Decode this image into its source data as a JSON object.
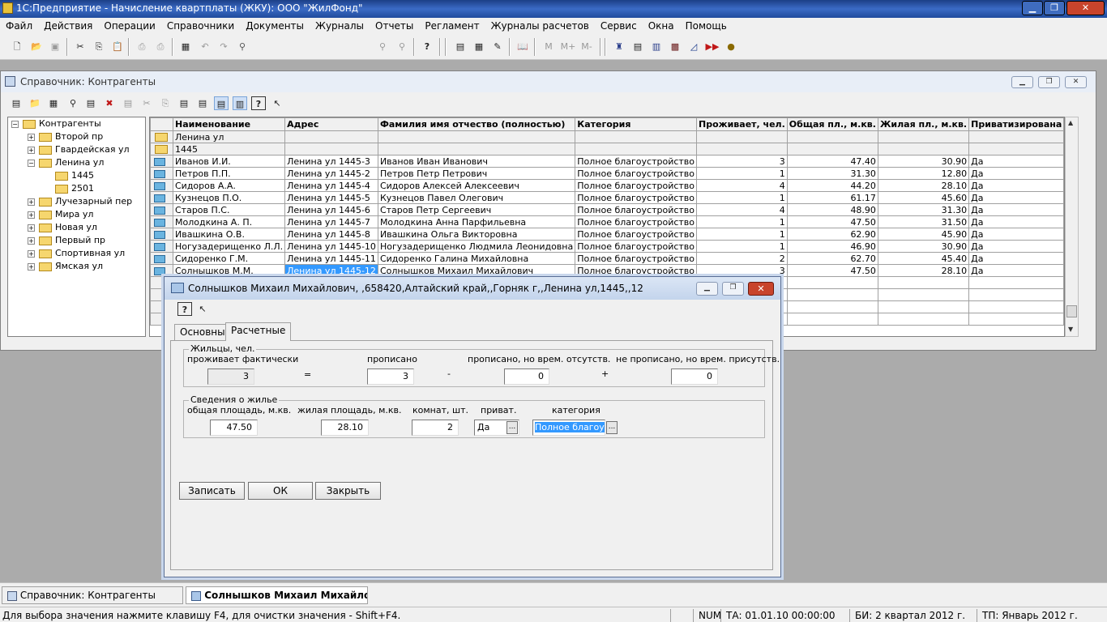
{
  "app": {
    "title": "1С:Предприятие - Начисление квартплаты (ЖКУ): ООО \"ЖилФонд\""
  },
  "menu": [
    "Файл",
    "Действия",
    "Операции",
    "Справочники",
    "Документы",
    "Журналы",
    "Отчеты",
    "Регламент",
    "Журналы расчетов",
    "Сервис",
    "Окна",
    "Помощь"
  ],
  "toolbar_misc": {
    "m": "M",
    "mplus": "M+",
    "mminus": "M-"
  },
  "sprav": {
    "title": "Справочник: Контрагенты",
    "tree": [
      {
        "label": "Контрагенты",
        "exp": "−"
      },
      {
        "label": "Второй пр",
        "exp": "+"
      },
      {
        "label": "Гвардейская ул",
        "exp": "+"
      },
      {
        "label": "Ленина ул",
        "exp": "−"
      },
      {
        "label": "1445",
        "exp": ""
      },
      {
        "label": "2501",
        "exp": ""
      },
      {
        "label": "Лучезарный пер",
        "exp": "+"
      },
      {
        "label": "Мира ул",
        "exp": "+"
      },
      {
        "label": "Новая ул",
        "exp": "+"
      },
      {
        "label": "Первый пр",
        "exp": "+"
      },
      {
        "label": "Спортивная ул",
        "exp": "+"
      },
      {
        "label": "Ямская ул",
        "exp": "+"
      }
    ],
    "columns": [
      "Наименование",
      "Адрес",
      "Фамилия имя отчество (полностью)",
      "Категория",
      "Проживает, чел.",
      "Общая пл., м.кв.",
      "Жилая пл., м.кв.",
      "Приватизирована"
    ],
    "groups": [
      "Ленина ул",
      "1445"
    ],
    "rows": [
      [
        "Иванов И.И.",
        "Ленина ул 1445-3",
        "Иванов Иван Иванович",
        "Полное благоустройство",
        "3",
        "47.40",
        "30.90",
        "Да"
      ],
      [
        "Петров П.П.",
        "Ленина ул 1445-2",
        "Петров Петр Петрович",
        "Полное благоустройство",
        "1",
        "31.30",
        "12.80",
        "Да"
      ],
      [
        "Сидоров А.А.",
        "Ленина ул 1445-4",
        "Сидоров Алексей Алексеевич",
        "Полное благоустройство",
        "4",
        "44.20",
        "28.10",
        "Да"
      ],
      [
        "Кузнецов П.О.",
        "Ленина ул 1445-5",
        "Кузнецов Павел Олегович",
        "Полное благоустройство",
        "1",
        "61.17",
        "45.60",
        "Да"
      ],
      [
        "Старов П.С.",
        "Ленина ул 1445-6",
        "Старов Петр Сергеевич",
        "Полное благоустройство",
        "4",
        "48.90",
        "31.30",
        "Да"
      ],
      [
        "Молодкина А. П.",
        "Ленина ул 1445-7",
        "Молодкина Анна Парфильевна",
        "Полное благоустройство",
        "1",
        "47.50",
        "31.50",
        "Да"
      ],
      [
        "Ивашкина О.В.",
        "Ленина ул 1445-8",
        "Ивашкина Ольга Викторовна",
        "Полное благоустройство",
        "1",
        "62.90",
        "45.90",
        "Да"
      ],
      [
        "Ногузадерищенко Л.Л.",
        "Ленина ул 1445-10",
        "Ногузадерищенко Людмила Леонидовна",
        "Полное благоустройство",
        "1",
        "46.90",
        "30.90",
        "Да"
      ],
      [
        "Сидоренко Г.М.",
        "Ленина ул 1445-11",
        "Сидоренко Галина Михайловна",
        "Полное благоустройство",
        "2",
        "62.70",
        "45.40",
        "Да"
      ],
      [
        "Солнышков М.М.",
        "Ленина ул 1445-12",
        "Солнышков Михаил Михайлович",
        "Полное благоустройство",
        "3",
        "47.50",
        "28.10",
        "Да"
      ]
    ]
  },
  "dialog": {
    "title": "Солнышков Михаил Михайлович, ,658420,Алтайский край,,Горняк г,,Ленина ул,1445,,12",
    "tabs": [
      "Основные",
      "Расчетные"
    ],
    "residents": {
      "title": "Жильцы, чел.",
      "l1": "проживает фактически",
      "v1": "3",
      "eq": "=",
      "l2": "прописано",
      "v2": "3",
      "minus": "-",
      "l3": "прописано, но врем. отсутств.",
      "v3": "0",
      "plus": "+",
      "l4": "не прописано, но врем. присутств.",
      "v4": "0"
    },
    "housing": {
      "title": "Сведения о жилье",
      "l1": "общая площадь, м.кв.",
      "v1": "47.50",
      "l2": "жилая площадь, м.кв.",
      "v2": "28.10",
      "l3": "комнат, шт.",
      "v3": "2",
      "l4": "приват.",
      "v4": "Да",
      "l5": "категория",
      "v5": "Полное благоуст"
    },
    "buttons": {
      "save": "Записать",
      "ok": "ОК",
      "close": "Закрыть"
    }
  },
  "taskbar": [
    "Справочник: Контрагенты",
    "Солнышков Михаил Михайлови..."
  ],
  "status": {
    "hint": "Для выбора значения нажмите клавишу F4, для очистки значения - Shift+F4.",
    "num": "NUM",
    "ta": "ТА: 01.01.10  00:00:00",
    "bi": "БИ: 2 квартал 2012 г.",
    "tp": "ТП: Январь 2012 г."
  }
}
